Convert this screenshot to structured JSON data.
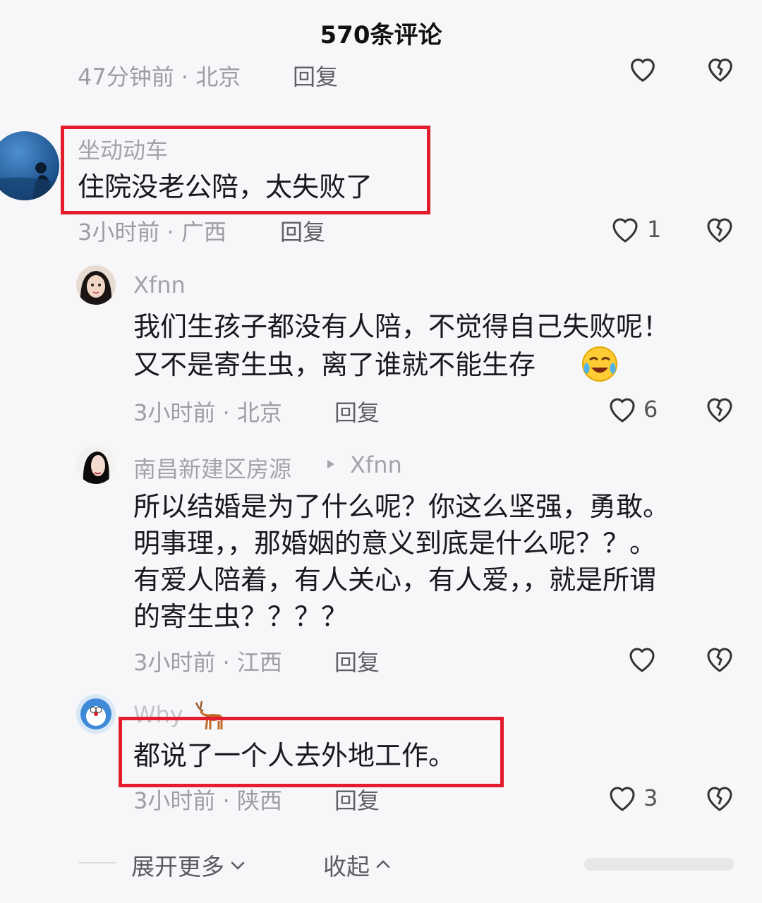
{
  "header": {
    "title": "570条评论"
  },
  "partial_row": {
    "meta": "47分钟前 · 北京",
    "reply": "回复"
  },
  "comments": [
    {
      "user": "坐动动车",
      "text": "住院没老公陪，太失败了",
      "meta": "3小时前 · 广西",
      "reply": "回复",
      "likes": "1"
    },
    {
      "user": "Xfnn",
      "text_line1": "我们生孩子都没有人陪，不觉得自己失败呢！",
      "text_line2": "又不是寄生虫，离了谁就不能生存",
      "emoji": "crying-laughing-face-icon",
      "meta": "3小时前 · 北京",
      "reply": "回复",
      "likes": "6"
    },
    {
      "user": "南昌新建区房源",
      "reply_to": "Xfnn",
      "text_lines": [
        "所以结婚是为了什么呢？你这么坚强，勇敢。",
        "明事理，，那婚姻的意义到底是什么呢？？。",
        "有爱人陪着，有人关心，有人爱，，就是所谓",
        "的寄生虫？？？？"
      ],
      "meta": "3小时前 · 江西",
      "reply": "回复"
    },
    {
      "user": "Why",
      "text": "都说了一个人去外地工作。",
      "meta": "3小时前 · 陕西",
      "reply": "回复",
      "likes": "3"
    }
  ],
  "footer": {
    "expand": "展开更多",
    "collapse": "收起"
  },
  "colors": {
    "highlight": "#e31d2d",
    "background": "#f7f7f9"
  }
}
